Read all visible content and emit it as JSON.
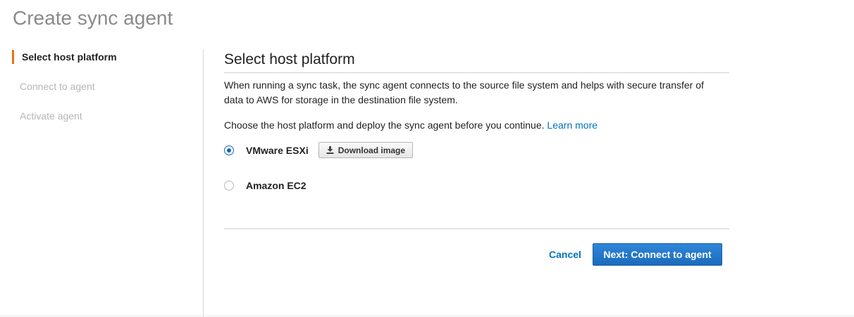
{
  "page": {
    "title": "Create sync agent"
  },
  "steps": [
    {
      "label": "Select host platform",
      "active": true
    },
    {
      "label": "Connect to agent",
      "active": false
    },
    {
      "label": "Activate agent",
      "active": false
    }
  ],
  "main": {
    "section_title": "Select host platform",
    "description": "When running a sync task, the sync agent connects to the source file system and helps with secure transfer of data to AWS for storage in the destination file system.",
    "choose_text": "Choose the host platform and deploy the sync agent before you continue.",
    "learn_more": "Learn more",
    "options": [
      {
        "label": "VMware ESXi",
        "selected": true,
        "button_label": "Download image",
        "button_icon": "download-icon"
      },
      {
        "label": "Amazon EC2",
        "selected": false
      }
    ]
  },
  "actions": {
    "cancel_label": "Cancel",
    "next_label": "Next: Connect to agent"
  },
  "colors": {
    "accent": "#ec7211",
    "link": "#0073bb",
    "primary_button": "#1c6bbd",
    "radio_selected": "#1166bb"
  }
}
